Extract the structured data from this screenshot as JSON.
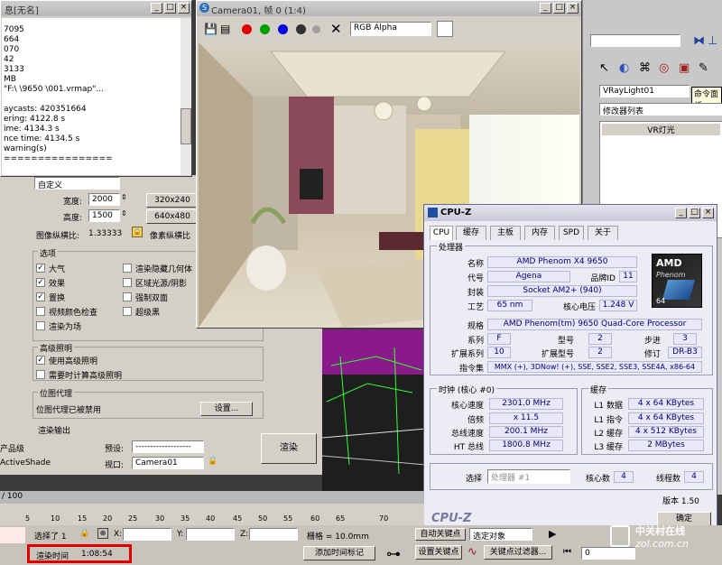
{
  "log": {
    "title": "息[无名]",
    "lines": [
      "7095",
      "664",
      "070",
      "42",
      "3133",
      "MB",
      "\"F:\\          \\9650       \\001.vrmap\"...",
      "",
      "aycasts: 420351664",
      "ering: 4122.8 s",
      "ime: 4134.3 s",
      "nce time: 4134.5 s",
      "warning(s)",
      "================"
    ]
  },
  "render_setup": {
    "preset_dd": "自定义",
    "width_label": "宽度:",
    "width_value": "2000",
    "height_label": "高度:",
    "height_value": "1500",
    "size_btn1": "320x240",
    "size_btn2": "640x480",
    "aspect_label": "图像纵横比:",
    "aspect_value": "1.33333",
    "pixel_aspect_label": "像素纵横比",
    "options_title": "选项",
    "opt_atmosphere": "大气",
    "opt_effects": "效果",
    "opt_displace": "置换",
    "opt_video_check": "视频颜色检查",
    "opt_render_to_fields": "渲染为场",
    "opt_render_hidden": "渲染隐藏几何体",
    "opt_area_lights": "区域光源/阴影",
    "opt_force_2sided": "强制双面",
    "opt_super_black": "超级黑",
    "adv_title": "高级照明",
    "adv_use": "使用高级照明",
    "adv_compute": "需要时计算高级照明",
    "bitmap_title": "位图代理",
    "bitmap_status": "位图代理已被禁用",
    "setup_btn": "设置...",
    "render_output_title": "渲染输出",
    "product_label": "产品级",
    "activeshade_label": "ActiveShade",
    "preset_label": "预设:",
    "preset_value": "-------------------",
    "viewport_label": "视口:",
    "viewport_value": "Camera01",
    "render_btn": "渲染"
  },
  "frame_window": {
    "title": "Camera01, 帧 0 (1:4)",
    "channel_value": "RGB Alpha",
    "colors": {
      "red": "#e00000",
      "green": "#00a000",
      "blue": "#0000e0"
    }
  },
  "cmd_panel": {
    "object_name": "VRayLight01",
    "modifier_list": "修改器列表",
    "item": "VR灯光",
    "tooltip": "命令面板"
  },
  "cpuz": {
    "title": "CPU-Z",
    "tabs": [
      "CPU",
      "缓存",
      "主板",
      "内存",
      "SPD",
      "关于"
    ],
    "processor_title": "处理器",
    "name_label": "名称",
    "name_value": "AMD Phenom X4 9650",
    "code_label": "代号",
    "code_value": "Agena",
    "brand_label": "品牌ID",
    "brand_value": "11",
    "package_label": "封装",
    "package_value": "Socket AM2+ (940)",
    "tech_label": "工艺",
    "tech_value": "65 nm",
    "voltage_label": "核心电压",
    "voltage_value": "1.248 V",
    "spec_label": "规格",
    "spec_value": "AMD Phenom(tm) 9650 Quad-Core Processor",
    "family_label": "系列",
    "family_value": "F",
    "model_label": "型号",
    "model_value": "2",
    "stepping_label": "步进",
    "stepping_value": "3",
    "extfamily_label": "扩展系列",
    "extfamily_value": "10",
    "extmodel_label": "扩展型号",
    "extmodel_value": "2",
    "revision_label": "修订",
    "revision_value": "DR-B3",
    "instr_label": "指令集",
    "instr_value": "MMX (+), 3DNow! (+), SSE, SSE2, SSE3, SSE4A, x86-64",
    "clock_title": "时钟 (核心 #0)",
    "core_speed_label": "核心速度",
    "core_speed_value": "2301.0 MHz",
    "multi_label": "倍频",
    "multi_value": "x 11.5",
    "bus_label": "总线速度",
    "bus_value": "200.1 MHz",
    "ht_label": "HT 总线",
    "ht_value": "1800.8 MHz",
    "cache_title": "缓存",
    "l1d_label": "L1 数据",
    "l1d_value": "4 x 64 KBytes",
    "l1i_label": "L1 指令",
    "l1i_value": "4 x 64 KBytes",
    "l2_label": "L2 缓存",
    "l2_value": "4 x 512 KBytes",
    "l3_label": "L3 缓存",
    "l3_value": "2 MBytes",
    "select_label": "选择",
    "select_value": "处理器 #1",
    "cores_label": "核心数",
    "cores_value": "4",
    "threads_label": "线程数",
    "threads_value": "4",
    "version": "版本 1.50",
    "ok_btn": "确定",
    "footer_logo": "CPU-Z",
    "amd_logo": "AMD",
    "phenom_logo": "Phenom",
    "phenom_num": "64"
  },
  "status": {
    "frame_counter": "/ 100",
    "ruler_ticks": [
      "5",
      "10",
      "15",
      "20",
      "25",
      "30",
      "35",
      "40",
      "45",
      "50",
      "55",
      "60",
      "65",
      "70"
    ],
    "selected_label": "选择了 1",
    "x_label": "X:",
    "y_label": "Y:",
    "z_label": "Z:",
    "grid_label": "栅格 = 10.0mm",
    "auto_key": "自动关键点",
    "selected_obj": "选定对象",
    "set_key": "设置关键点",
    "key_filter": "关键点过滤器...",
    "render_time_label": "渲染时间",
    "render_time_value": "1:08:54",
    "add_time_tag": "添加时间标记",
    "frame_field": "0"
  },
  "watermark": {
    "cn": "中关村在线",
    "url": "zol.com.cn"
  }
}
